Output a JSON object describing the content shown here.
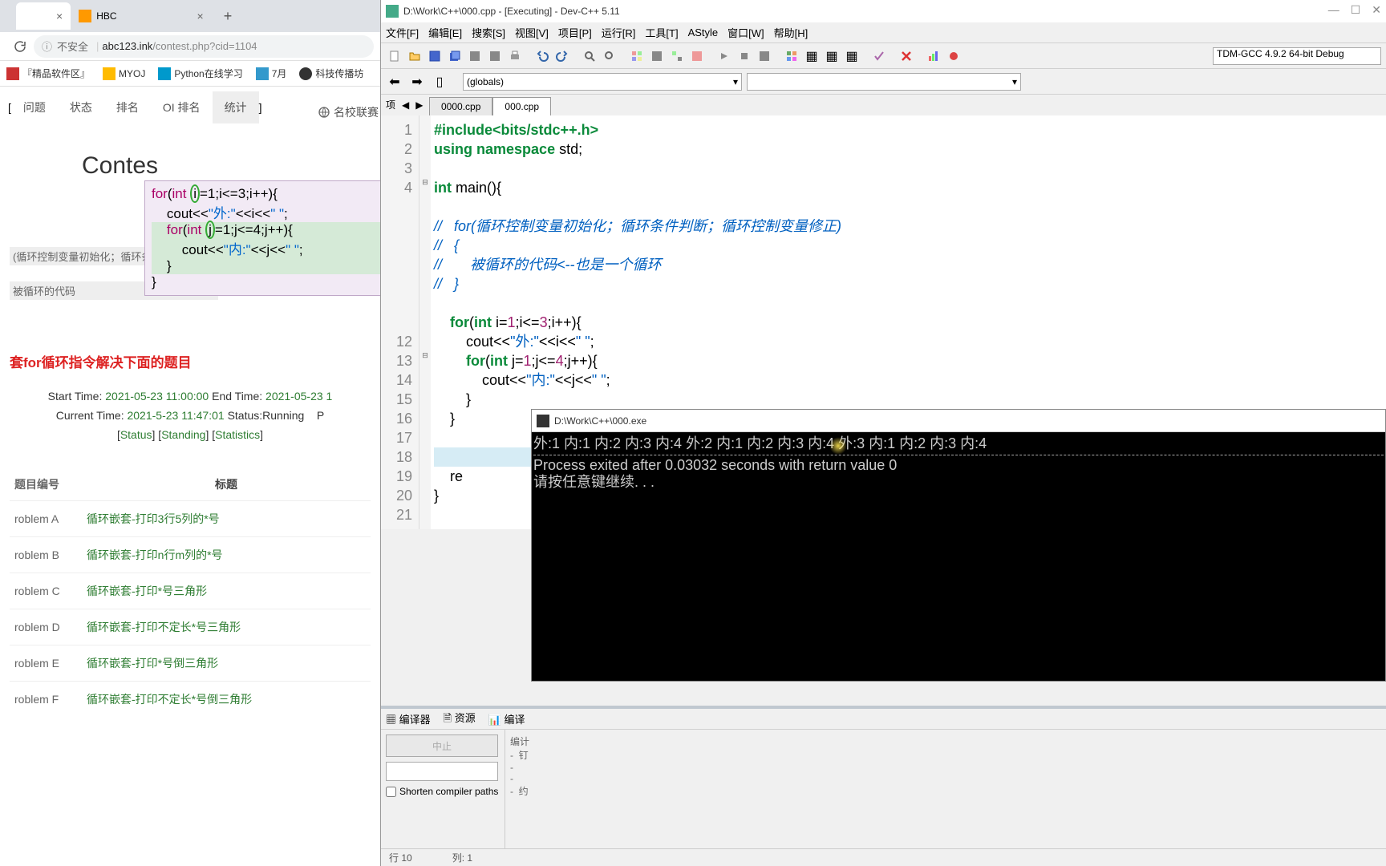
{
  "browser": {
    "tabs": [
      {
        "label": "",
        "active": true
      },
      {
        "label": "HBC",
        "active": false
      }
    ],
    "address": {
      "warning": "不安全",
      "domain": "abc123.ink",
      "path": "/contest.php?cid=1104"
    },
    "bookmarks": [
      "『精品软件区』",
      "MYOJ",
      "Python在线学习",
      "7月",
      "科技传播坊"
    ],
    "nav": {
      "items": [
        "问题",
        "状态",
        "排名",
        "OI 排名",
        "统计"
      ],
      "side": "名校联赛"
    },
    "contest_label": "Contes",
    "loop_text1": "(循环控制变量初始化；循环条件",
    "loop_text2": "被循环的代码",
    "section_title": "套for循环指令解决下面的题目",
    "time": {
      "start_label": "Start Time:",
      "start": "2021-05-23 11:00:00",
      "end_label": "End Time:",
      "end": "2021-05-23 1",
      "now_label": "Current Time:",
      "now": "2021-5-23 11:47:01",
      "status_label": "Status:",
      "status": "Running",
      "p": "P",
      "links": [
        "Status",
        "Standing",
        "Statistics"
      ]
    },
    "table": {
      "head_id": "题目编号",
      "head_title": "标题",
      "rows": [
        {
          "id": "roblem  A",
          "title": "循环嵌套-打印3行5列的*号"
        },
        {
          "id": "roblem  B",
          "title": "循环嵌套-打印n行m列的*号"
        },
        {
          "id": "roblem  C",
          "title": "循环嵌套-打印*号三角形"
        },
        {
          "id": "roblem  D",
          "title": "循环嵌套-打印不定长*号三角形"
        },
        {
          "id": "roblem  E",
          "title": "循环嵌套-打印*号倒三角形"
        },
        {
          "id": "roblem  F",
          "title": "循环嵌套-打印不定长*号倒三角形"
        }
      ]
    }
  },
  "snippet": {
    "l1": "for(int i=1;i<=3;i++){",
    "l2": "    cout<<\"外:\"<<i<<\" \";",
    "l3": "    for(int j=1;j<=4;j++){",
    "l4": "        cout<<\"内:\"<<j<<\" \";",
    "l5": "    }",
    "l6": "}"
  },
  "devcpp": {
    "title": "D:\\Work\\C++\\000.cpp - [Executing] - Dev-C++ 5.11",
    "menus": [
      "文件[F]",
      "编辑[E]",
      "搜索[S]",
      "视图[V]",
      "项目[P]",
      "运行[R]",
      "工具[T]",
      "AStyle",
      "窗口[W]",
      "帮助[H]"
    ],
    "compiler": "TDM-GCC 4.9.2 64-bit Debug",
    "globals": "(globals)",
    "toolbar3_label": "项",
    "filetabs": [
      "0000.cpp",
      "000.cpp"
    ],
    "lines": [
      "1",
      "2",
      "3",
      "4",
      "",
      "",
      "",
      "",
      "",
      "",
      "",
      "12",
      "13",
      "14",
      "15",
      "16",
      "17",
      "18",
      "19",
      "20",
      "21"
    ],
    "bottom": {
      "tabs": [
        "编译器",
        "资源",
        "编译"
      ],
      "stop": "中止",
      "check": "Shorten compiler paths",
      "right_label": "编计"
    },
    "status": {
      "line": "行    10",
      "col": "列:    1"
    }
  },
  "console": {
    "title": "D:\\Work\\C++\\000.exe",
    "output": "外:1 内:1 内:2 内:3 内:4 外:2 内:1 内:2 内:3 内:4 外:3 内:1 内:2 内:3 内:4",
    "exit": "Process exited after 0.03032 seconds with return value 0",
    "prompt": "请按任意键继续. . ."
  }
}
